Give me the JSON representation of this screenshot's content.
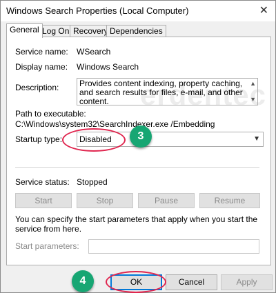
{
  "window": {
    "title": "Windows Search Properties (Local Computer)",
    "close_icon": "close-icon"
  },
  "tabs": [
    {
      "label": "General",
      "active": true
    },
    {
      "label": "Log On",
      "active": false
    },
    {
      "label": "Recovery",
      "active": false
    },
    {
      "label": "Dependencies",
      "active": false
    }
  ],
  "general": {
    "service_name_label": "Service name:",
    "service_name": "WSearch",
    "display_name_label": "Display name:",
    "display_name": "Windows Search",
    "description_label": "Description:",
    "description": "Provides content indexing, property caching, and search results for files, e-mail, and other content.",
    "path_label": "Path to executable:",
    "path": "C:\\Windows\\system32\\SearchIndexer.exe /Embedding",
    "startup_type_label": "Startup type:",
    "startup_type": "Disabled",
    "service_status_label": "Service status:",
    "service_status": "Stopped",
    "buttons": {
      "start": "Start",
      "stop": "Stop",
      "pause": "Pause",
      "resume": "Resume"
    },
    "params_text": "You can specify the start parameters that apply when you start the service from here.",
    "start_params_label": "Start parameters:",
    "start_params_value": ""
  },
  "dialog_buttons": {
    "ok": "OK",
    "cancel": "Cancel",
    "apply": "Apply"
  },
  "annotations": {
    "step3": "3",
    "step4": "4",
    "accent_color": "#17a673",
    "highlight_color": "#e0264f"
  }
}
